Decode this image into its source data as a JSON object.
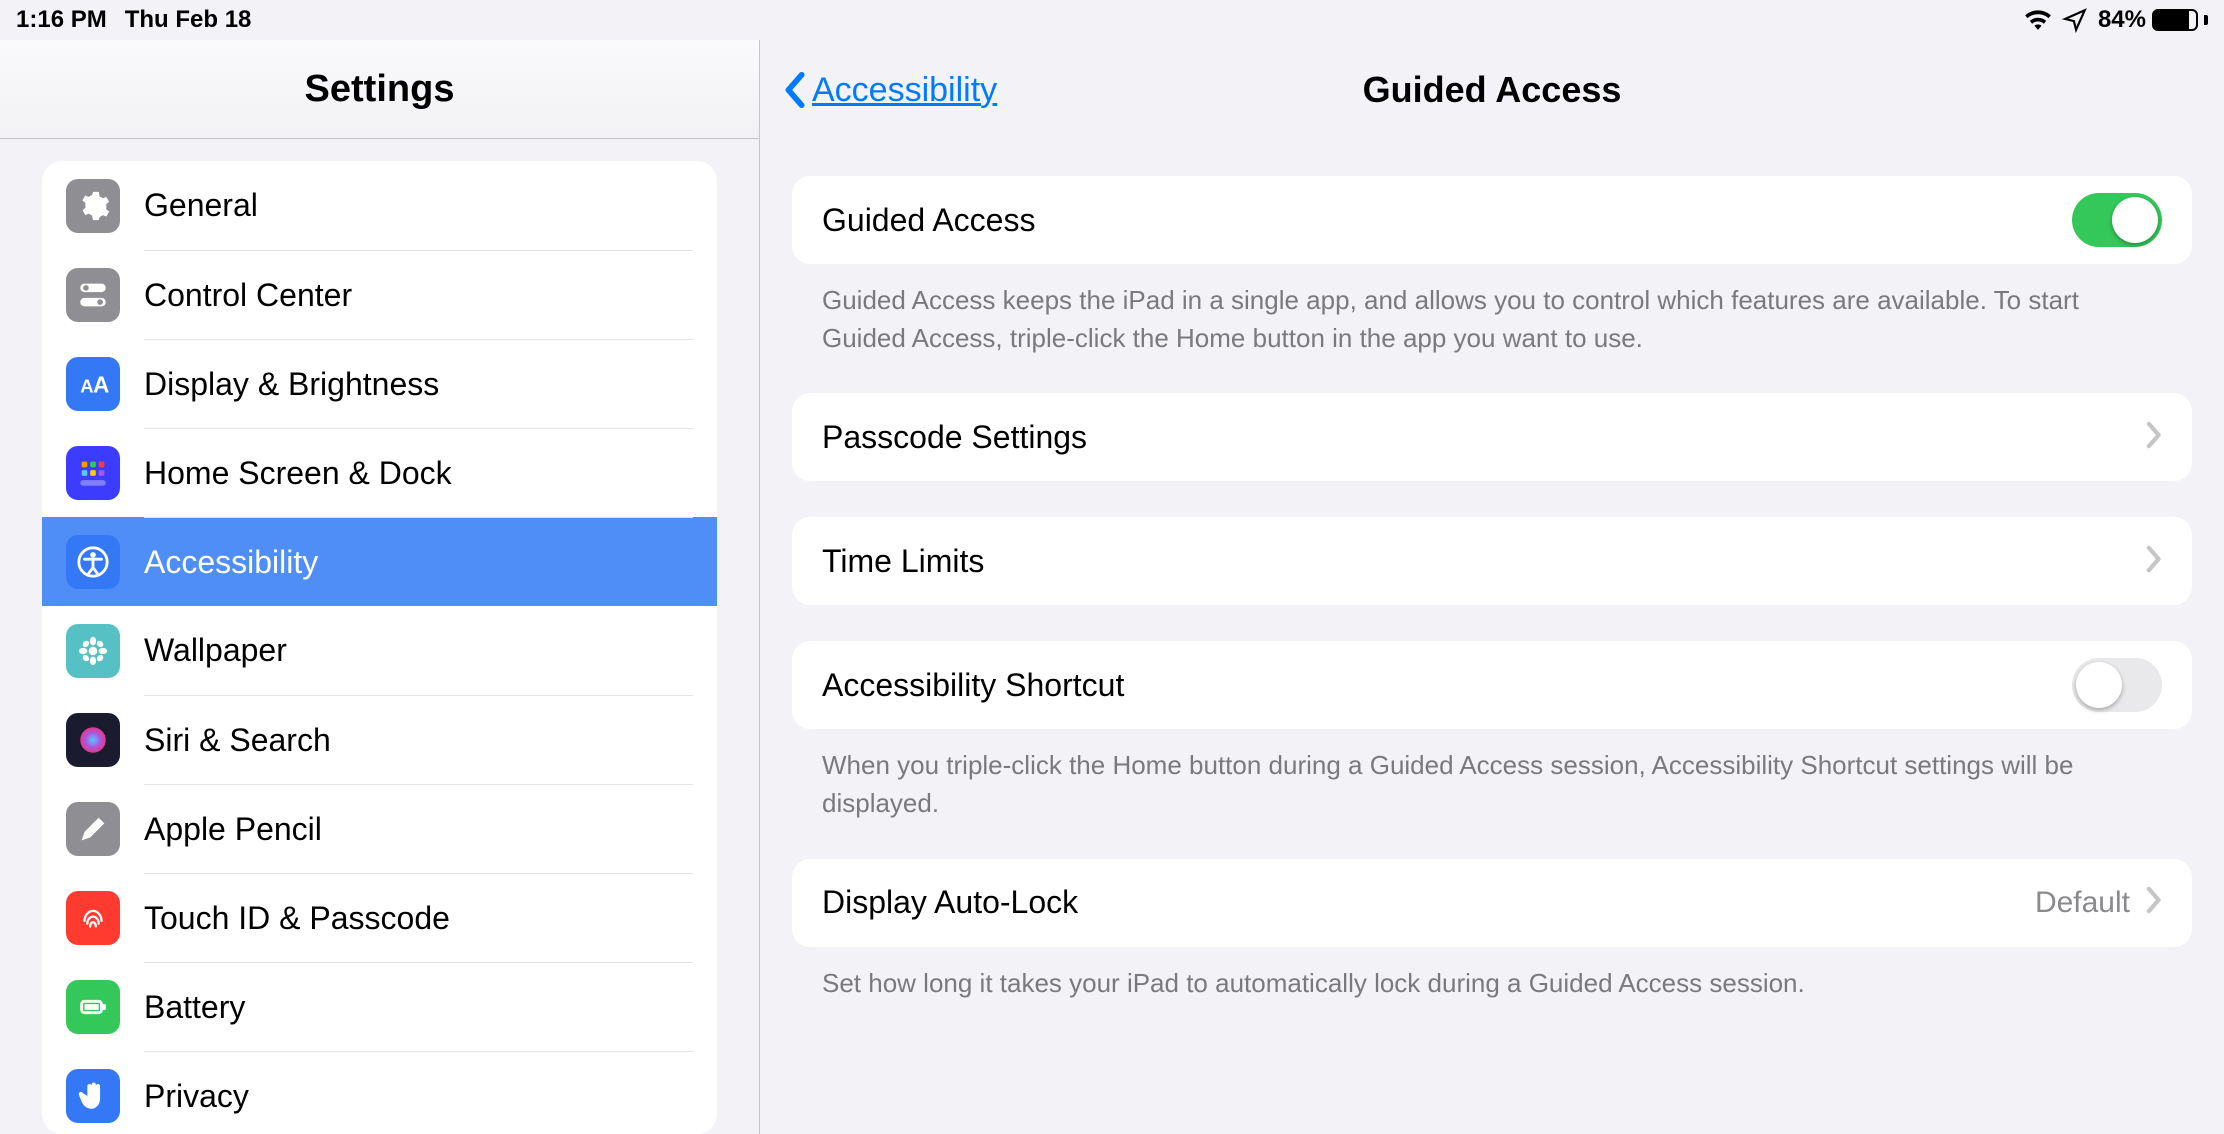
{
  "status": {
    "time": "1:16 PM",
    "date": "Thu Feb 18",
    "battery_pct": 84,
    "battery_text": "84%"
  },
  "sidebar": {
    "title": "Settings",
    "items": [
      {
        "label": "General"
      },
      {
        "label": "Control Center"
      },
      {
        "label": "Display & Brightness"
      },
      {
        "label": "Home Screen & Dock"
      },
      {
        "label": "Accessibility"
      },
      {
        "label": "Wallpaper"
      },
      {
        "label": "Siri & Search"
      },
      {
        "label": "Apple Pencil"
      },
      {
        "label": "Touch ID & Passcode"
      },
      {
        "label": "Battery"
      },
      {
        "label": "Privacy"
      }
    ],
    "selected_index": 4
  },
  "detail": {
    "back_label": "Accessibility",
    "title": "Guided Access",
    "group1": {
      "row_label": "Guided Access",
      "toggle_on": true,
      "footer": "Guided Access keeps the iPad in a single app, and allows you to control which features are available. To start Guided Access, triple-click the Home button in the app you want to use."
    },
    "group2": {
      "row_label": "Passcode Settings"
    },
    "group3": {
      "row_label": "Time Limits"
    },
    "group4": {
      "row_label": "Accessibility Shortcut",
      "toggle_on": false,
      "footer": "When you triple-click the Home button during a Guided Access session, Accessibility Shortcut settings will be displayed."
    },
    "group5": {
      "row_label": "Display Auto-Lock",
      "value": "Default",
      "footer": "Set how long it takes your iPad to automatically lock during a Guided Access session."
    }
  }
}
